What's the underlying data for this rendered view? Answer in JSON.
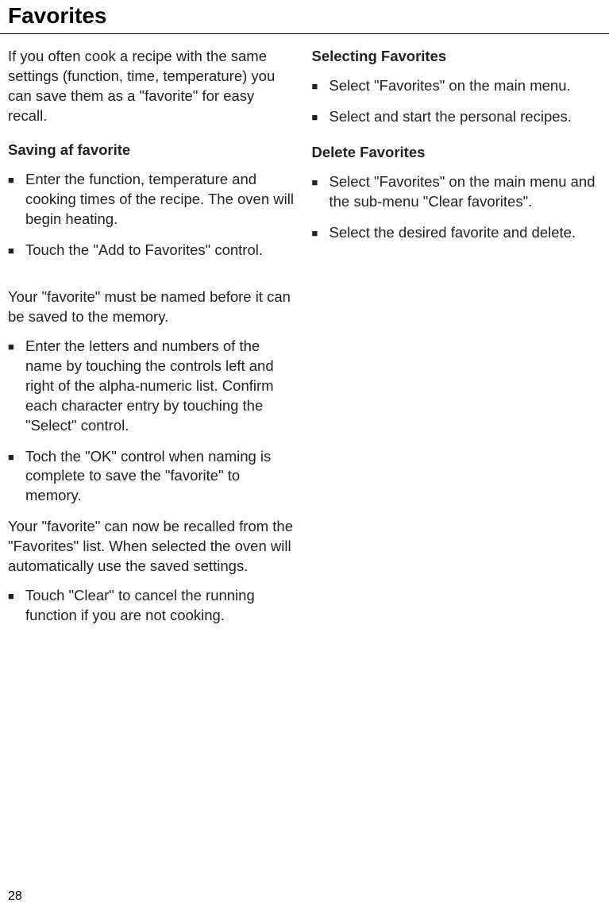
{
  "page_title": "Favorites",
  "page_number": "28",
  "left_column": {
    "intro": "If you often cook a recipe with the same settings (function, time, temperature) you can save them as a \"favorite\" for easy recall.",
    "heading1": "Saving af favorite",
    "bullets1": [
      "Enter the function, temperature and cooking times of the recipe. The oven will begin heating.",
      "Touch the \"Add to Favorites\" control."
    ],
    "para2": "Your \"favorite\" must be named before it can be saved to the memory.",
    "bullets2": [
      "Enter the letters and numbers of the name by touching the controls left and right of the alpha-numeric list. Confirm each character entry by touching the \"Select\" control.",
      "Toch the \"OK\" control when naming is complete to save the \"favorite\" to memory."
    ],
    "para3": "Your \"favorite\" can now be recalled from the \"Favorites\" list. When selected the oven will automatically use the saved settings.",
    "bullets3": [
      "Touch \"Clear\" to cancel the running function if you are not cooking."
    ]
  },
  "right_column": {
    "heading1": "Selecting Favorites",
    "bullets1": [
      "Select \"Favorites\" on the main menu.",
      "Select and start the personal recipes."
    ],
    "heading2": "Delete Favorites",
    "bullets2": [
      "Select \"Favorites\" on the main menu and the sub-menu \"Clear favorites\".",
      "Select the desired favorite and delete."
    ]
  }
}
